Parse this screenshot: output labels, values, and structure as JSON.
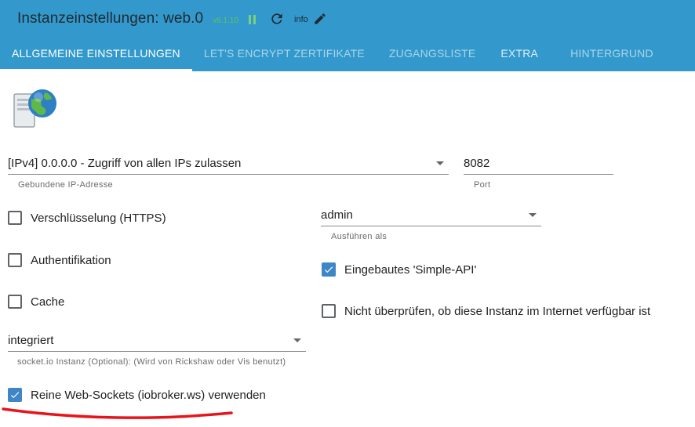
{
  "header": {
    "title": "Instanzeinstellungen: web.0",
    "version": "v6.1.10",
    "info_label": "info"
  },
  "tabs": [
    {
      "label": "Allgemeine Einstellungen",
      "active": true
    },
    {
      "label": "Let's Encrypt Zertifikate",
      "active": false
    },
    {
      "label": "Zugangsliste",
      "active": false
    },
    {
      "label": "Extra",
      "active": false
    },
    {
      "label": "Hintergrund",
      "active": false
    }
  ],
  "general": {
    "ip_select": {
      "value": "[IPv4] 0.0.0.0 - Zugriff von allen IPs zulassen",
      "helper": "Gebundene IP-Adresse"
    },
    "port": {
      "value": "8082",
      "helper": "Port"
    },
    "run_as": {
      "value": "admin",
      "helper": "Ausführen als"
    },
    "socketio": {
      "value": "integriert",
      "helper": "socket.io Instanz (Optional): (Wird von Rickshaw oder Vis benutzt)"
    },
    "checkboxes": {
      "https": {
        "label": "Verschlüsselung (HTTPS)",
        "checked": false
      },
      "auth": {
        "label": "Authentifikation",
        "checked": false
      },
      "cache": {
        "label": "Cache",
        "checked": false
      },
      "simple_api": {
        "label": "Eingebautes 'Simple-API'",
        "checked": true
      },
      "no_check": {
        "label": "Nicht überprüfen, ob diese Instanz im Internet verfügbar ist",
        "checked": false
      },
      "pure_ws": {
        "label": "Reine Web-Sockets (iobroker.ws) verwenden",
        "checked": true
      }
    }
  },
  "colors": {
    "header_bg": "#3399cc",
    "checkbox_checked": "#3e86c7",
    "annotation": "#e8141b",
    "version_text": "#5cc25c"
  },
  "icons": [
    "pause-icon",
    "refresh-icon",
    "edit-icon",
    "server-globe-icon",
    "check-icon"
  ]
}
